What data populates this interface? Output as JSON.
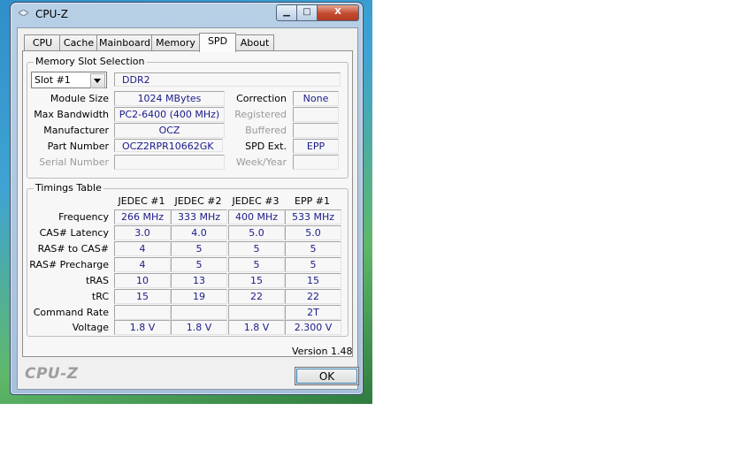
{
  "window": {
    "title": "CPU-Z",
    "min_label": "▁",
    "max_label": "□",
    "close_label": "X"
  },
  "tabs": [
    "CPU",
    "Cache",
    "Mainboard",
    "Memory",
    "SPD",
    "About"
  ],
  "active_tab": "SPD",
  "memory_slot": {
    "group_title": "Memory Slot Selection",
    "slot_value": "Slot #1",
    "type": "DDR2",
    "module_size_label": "Module Size",
    "module_size": "1024 MBytes",
    "max_bandwidth_label": "Max Bandwidth",
    "max_bandwidth": "PC2-6400 (400 MHz)",
    "manufacturer_label": "Manufacturer",
    "manufacturer": "OCZ",
    "part_number_label": "Part Number",
    "part_number": "OCZ2RPR10662GK",
    "serial_number_label": "Serial Number",
    "serial_number": "",
    "correction_label": "Correction",
    "correction": "None",
    "registered_label": "Registered",
    "registered": "",
    "buffered_label": "Buffered",
    "buffered": "",
    "spd_ext_label": "SPD Ext.",
    "spd_ext": "EPP",
    "week_year_label": "Week/Year",
    "week_year": ""
  },
  "timings": {
    "group_title": "Timings Table",
    "columns": [
      "JEDEC #1",
      "JEDEC #2",
      "JEDEC #3",
      "EPP #1"
    ],
    "rows": [
      {
        "label": "Frequency",
        "values": [
          "266 MHz",
          "333 MHz",
          "400 MHz",
          "533 MHz"
        ]
      },
      {
        "label": "CAS# Latency",
        "values": [
          "3.0",
          "4.0",
          "5.0",
          "5.0"
        ]
      },
      {
        "label": "RAS# to CAS#",
        "values": [
          "4",
          "5",
          "5",
          "5"
        ]
      },
      {
        "label": "RAS# Precharge",
        "values": [
          "4",
          "5",
          "5",
          "5"
        ]
      },
      {
        "label": "tRAS",
        "values": [
          "10",
          "13",
          "15",
          "15"
        ]
      },
      {
        "label": "tRC",
        "values": [
          "15",
          "19",
          "22",
          "22"
        ]
      },
      {
        "label": "Command Rate",
        "values": [
          "",
          "",
          "",
          "2T"
        ]
      },
      {
        "label": "Voltage",
        "values": [
          "1.8 V",
          "1.8 V",
          "1.8 V",
          "2.300 V"
        ]
      }
    ]
  },
  "footer": {
    "version": "Version 1.48",
    "logo": "CPU-Z",
    "ok_label": "OK"
  }
}
